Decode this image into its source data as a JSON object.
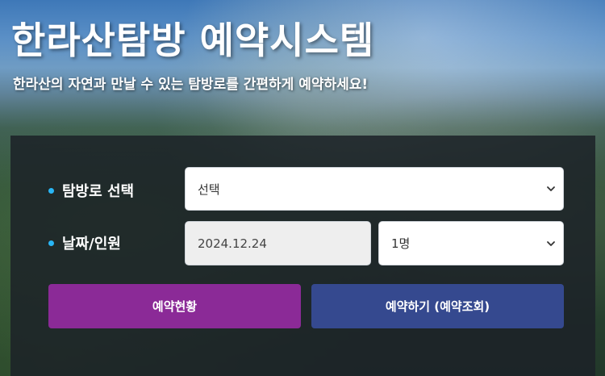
{
  "header": {
    "title": "한라산탐방 예약시스템",
    "subtitle": "한라산의 자연과 만날 수 있는 탐방로를 간편하게 예약하세요!"
  },
  "form": {
    "route_label": "탐방로 선택",
    "route_value": "선택",
    "date_people_label": "날짜/인원",
    "date_value": "2024.12.24",
    "people_value": "1명"
  },
  "buttons": {
    "status_label": "예약현황",
    "reserve_label": "예약하기 (예약조회)"
  },
  "colors": {
    "bullet": "#29b6f6",
    "status_button": "#8b2a97",
    "reserve_button": "#35498f",
    "panel": "#1c2228"
  },
  "icons": {
    "select_chevron": "chevron-down-icon",
    "label_bullet": "bullet-dot-icon"
  }
}
